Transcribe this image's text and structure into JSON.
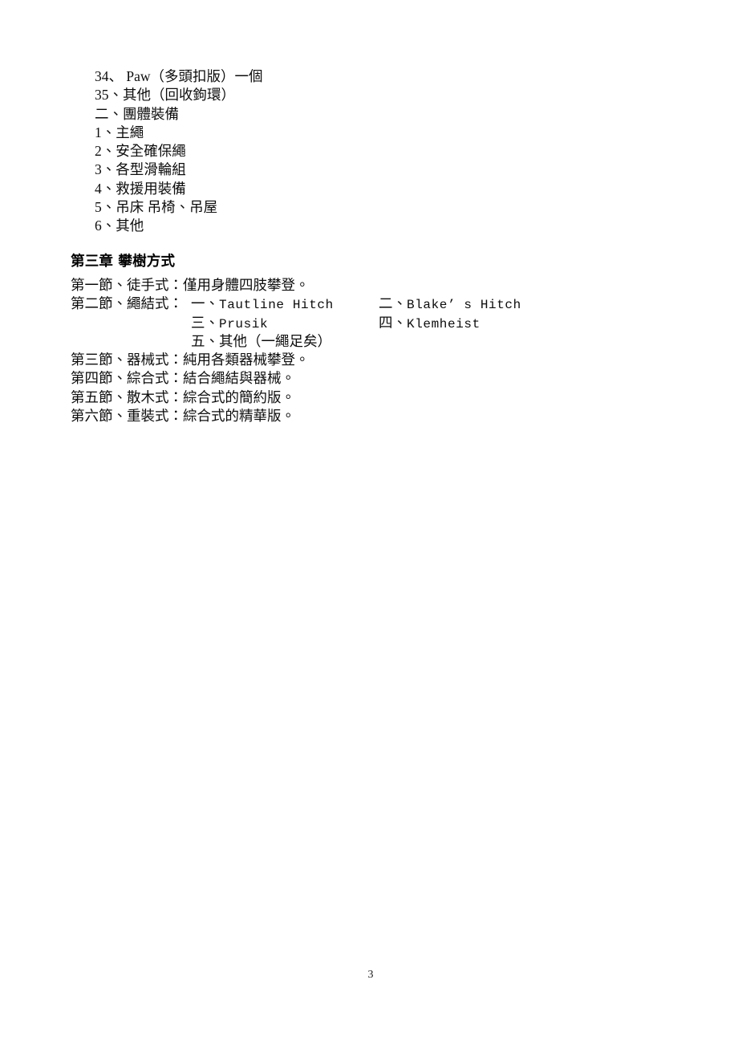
{
  "document": {
    "page_number": "3"
  },
  "equipment_list": {
    "items": [
      "34、 Paw（多頭扣版）一個",
      "35、其他（回收鉤環）",
      "二、團體裝備",
      "1、主繩",
      "2、安全確保繩",
      "3、各型滑輪組",
      "4、救援用裝備",
      "5、吊床 吊椅、吊屋",
      "6、其他"
    ]
  },
  "chapter": {
    "heading": "第三章 攀樹方式"
  },
  "sections": {
    "section_1": "第一節、徒手式：僅用身體四肢攀登。",
    "section_2_lead": "第二節、繩結式：",
    "knots": {
      "row1": {
        "col1_num": "一、",
        "col1_name": "Tautline Hitch",
        "col2_num": "二、",
        "col2_name": "Blake’ s Hitch"
      },
      "row2": {
        "col1_num": "三、",
        "col1_name": "Prusik",
        "col2_num": "四、",
        "col2_name": "Klemheist"
      },
      "row3": {
        "col1_num": "五、",
        "col1_name": "其他（一繩足矣）"
      }
    },
    "section_3": "第三節、器械式：純用各類器械攀登。",
    "section_4": "第四節、綜合式：結合繩結與器械。",
    "section_5": "第五節、散木式：綜合式的簡約版。",
    "section_6": "第六節、重裝式：綜合式的精華版。"
  }
}
